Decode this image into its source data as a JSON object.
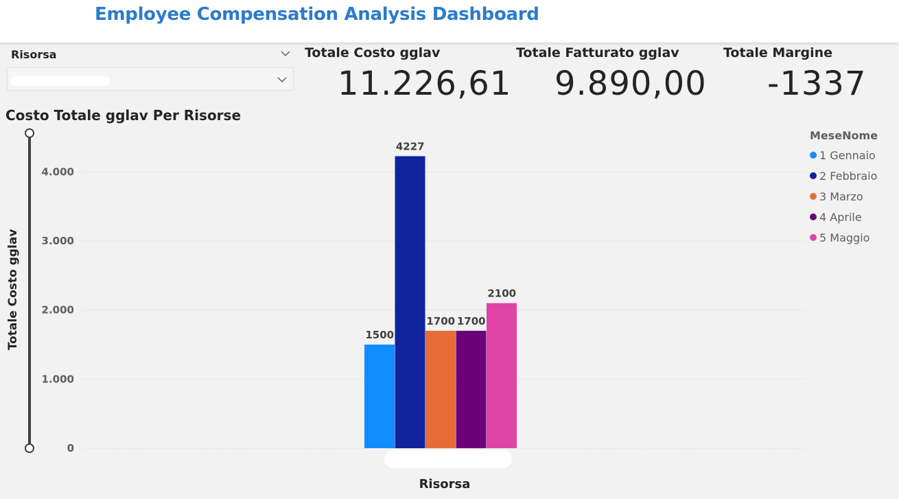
{
  "header": {
    "title": "Employee Compensation Analysis Dashboard"
  },
  "slicer": {
    "label": "Risorsa",
    "selected_value": "",
    "chevron_icon": "chevron-down-icon"
  },
  "cards": [
    {
      "label": "Totale Costo gglav",
      "value": "11.226,61"
    },
    {
      "label": "Totale Fatturato gglav",
      "value": "9.890,00"
    },
    {
      "label": "Totale Margine",
      "value": "-1337"
    }
  ],
  "chart_data": {
    "type": "bar",
    "title": "Costo Totale gglav Per Risorse",
    "xlabel": "Risorsa",
    "ylabel": "Totale Costo gglav",
    "ylim": [
      0,
      4600
    ],
    "yticks": [
      0,
      1000,
      2000,
      3000,
      4000
    ],
    "ytick_labels": [
      "0",
      "1.000",
      "2.000",
      "3.000",
      "4.000"
    ],
    "grid": true,
    "legend_title": "MeseNome",
    "legend_position": "top-right",
    "categories": [
      ""
    ],
    "series": [
      {
        "name": "1 Gennaio",
        "color": "#118dff",
        "values": [
          1500
        ]
      },
      {
        "name": "2 Febbraio",
        "color": "#12239e",
        "values": [
          4227
        ]
      },
      {
        "name": "3 Marzo",
        "color": "#e66c37",
        "values": [
          1700
        ]
      },
      {
        "name": "4 Aprile",
        "color": "#6b007b",
        "values": [
          1700
        ]
      },
      {
        "name": "5 Maggio",
        "color": "#e044a7",
        "values": [
          2100
        ]
      }
    ]
  }
}
